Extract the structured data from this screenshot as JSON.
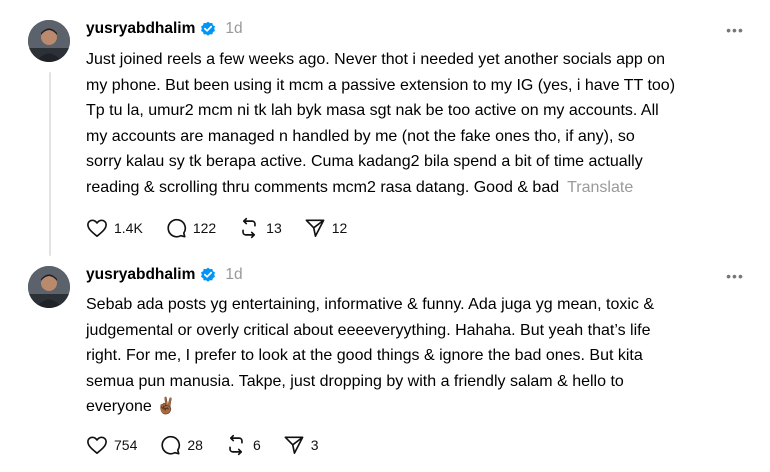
{
  "posts": [
    {
      "username": "yusryabdhalim",
      "time": "1d",
      "lines": [
        "Just joined reels a few weeks ago. Never thot i needed yet another socials app on",
        "my phone. But been using it mcm a passive extension to my IG (yes, i have TT too)",
        "Tp tu la, umur2 mcm ni tk lah byk masa sgt nak be too active on my accounts. All",
        "my accounts are managed n handled by me (not the fake ones tho, if any), so",
        "sorry kalau sy tk berapa active. Cuma kadang2 bila spend a bit of time actually",
        "reading & scrolling thru comments mcm2 rasa datang. Good & bad"
      ],
      "translate": "Translate",
      "likes": "1.4K",
      "replies": "122",
      "reposts": "13",
      "shares": "12"
    },
    {
      "username": "yusryabdhalim",
      "time": "1d",
      "lines": [
        "Sebab ada posts yg entertaining, informative & funny. Ada juga yg mean, toxic &",
        "judgemental or overly critical about eeeeveryything. Hahaha. But yeah that’s life",
        "right. For me, I prefer to look at the good things & ignore the bad ones. But kita",
        "semua pun manusia. Takpe, just dropping by with a friendly salam & hello to",
        "everyone ✌🏾"
      ],
      "likes": "754",
      "replies": "28",
      "reposts": "6",
      "shares": "3"
    }
  ],
  "colors": {
    "verified": "#0095f6",
    "muted": "#999999",
    "thread_line": "#e3e3e3"
  }
}
